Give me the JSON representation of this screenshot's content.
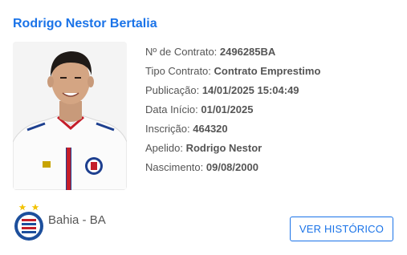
{
  "player": {
    "name": "Rodrigo Nestor Bertalia",
    "photo_alt": "Rodrigo Nestor",
    "details": [
      {
        "label": "Nº de Contrato: ",
        "value": "2496285BA"
      },
      {
        "label": "Tipo Contrato: ",
        "value": "Contrato Emprestimo"
      },
      {
        "label": "Publicação: ",
        "value": "14/01/2025 15:04:49"
      },
      {
        "label": "Data Início: ",
        "value": "01/01/2025"
      },
      {
        "label": "Inscrição: ",
        "value": "464320"
      },
      {
        "label": "Apelido: ",
        "value": "Rodrigo Nestor"
      },
      {
        "label": "Nascimento: ",
        "value": "09/08/2000"
      }
    ]
  },
  "club": {
    "name": "Bahia - BA",
    "crest_icon": "bahia-crest-icon"
  },
  "actions": {
    "history_label": "VER HISTÓRICO"
  },
  "colors": {
    "accent": "#1a73e8",
    "text": "#555555"
  }
}
